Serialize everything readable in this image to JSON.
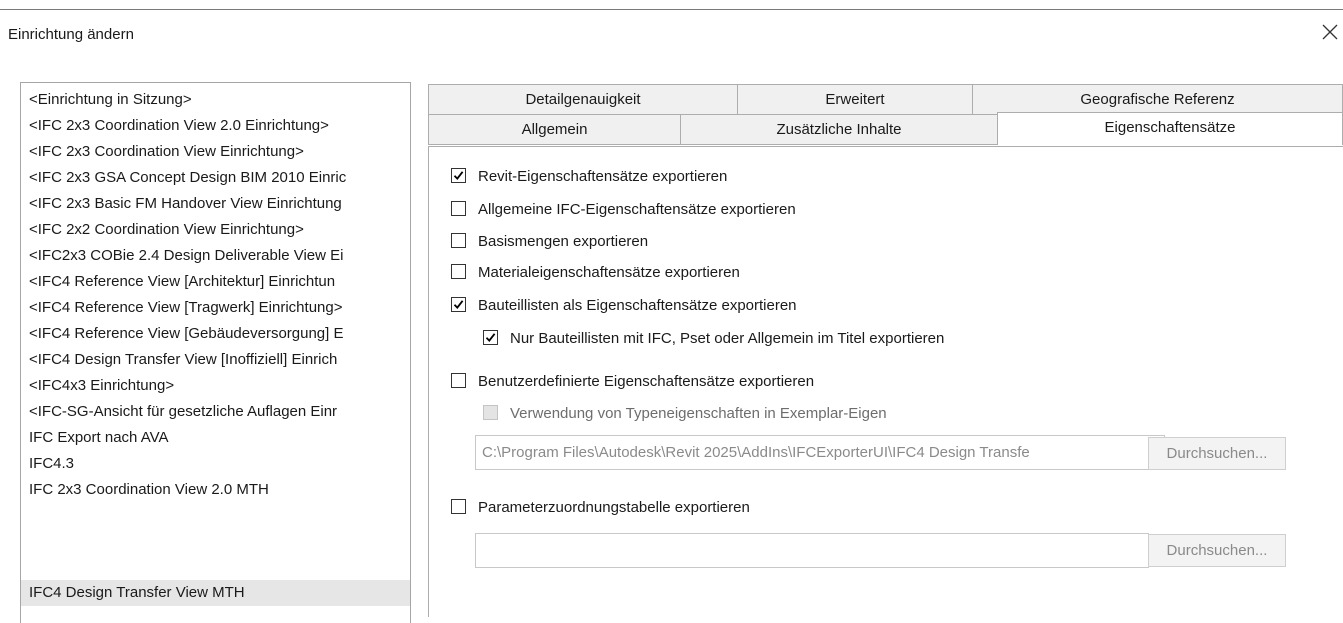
{
  "window": {
    "title": "Einrichtung ändern",
    "close_icon": "close-icon"
  },
  "setups": [
    "<Einrichtung in Sitzung>",
    "<IFC 2x3 Coordination View 2.0 Einrichtung>",
    "<IFC 2x3 Coordination View Einrichtung>",
    "<IFC 2x3 GSA Concept Design BIM 2010 Einric",
    "<IFC 2x3 Basic FM Handover View Einrichtung",
    "<IFC 2x2 Coordination View Einrichtung>",
    "<IFC2x3 COBie 2.4 Design Deliverable View Ei",
    "<IFC4 Reference View [Architektur] Einrichtun",
    "<IFC4 Reference View [Tragwerk] Einrichtung>",
    "<IFC4 Reference View [Gebäudeversorgung] E",
    "<IFC4 Design Transfer View [Inoffiziell] Einrich",
    "<IFC4x3 Einrichtung>",
    "<IFC-SG-Ansicht für gesetzliche Auflagen Einr",
    "IFC Export nach AVA",
    "IFC4.3",
    "IFC 2x3 Coordination View 2.0 MTH",
    "IFC4 Design Transfer View MTH"
  ],
  "selected_setup": "IFC4 Design Transfer View MTH",
  "tabs": {
    "detail": "Detailgenauigkeit",
    "advanced": "Erweitert",
    "georef": "Geografische Referenz",
    "general": "Allgemein",
    "additional": "Zusätzliche Inhalte",
    "property_sets": "Eigenschaftensätze"
  },
  "active_tab": "Eigenschaftensätze",
  "options": {
    "revit_psets": {
      "label": "Revit-Eigenschaftensätze exportieren",
      "checked": true
    },
    "ifc_common_psets": {
      "label": "Allgemeine IFC-Eigenschaftensätze exportieren",
      "checked": false
    },
    "base_quantities": {
      "label": "Basismengen exportieren",
      "checked": false
    },
    "material_psets": {
      "label": "Materialeigenschaftensätze exportieren",
      "checked": false
    },
    "schedules_as_psets": {
      "label": "Bauteillisten als Eigenschaftensätze exportieren",
      "checked": true
    },
    "schedules_filter": {
      "label": "Nur Bauteillisten mit IFC, Pset oder Allgemein im Titel exportieren",
      "checked": true
    },
    "user_defined_psets": {
      "label": "Benutzerdefinierte Eigenschaftensätze exportieren",
      "checked": false
    },
    "type_props_in_instance": {
      "label": "Verwendung von Typeneigenschaften in Exemplar-Eigen",
      "checked": false,
      "disabled": true
    },
    "parameter_mapping": {
      "label": "Parameterzuordnungstabelle exportieren",
      "checked": false
    }
  },
  "user_defined_path": {
    "value": "C:\\Program Files\\Autodesk\\Revit 2025\\AddIns\\IFCExporterUI\\IFC4 Design Transfe",
    "browse_label": "Durchsuchen..."
  },
  "mapping_path": {
    "value": "",
    "browse_label": "Durchsuchen..."
  },
  "check_icon": "checkmark-icon"
}
